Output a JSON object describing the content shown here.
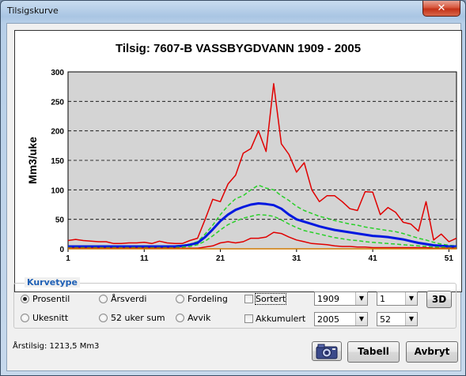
{
  "window": {
    "title": "Tilsigskurve",
    "close_label": "✕"
  },
  "chart_data": {
    "type": "line",
    "title": "Tilsig: 7607-B VASSBYGDVANN  1909 -  2005",
    "ylabel": "Mm3/uke",
    "xlabel": "",
    "xlim": [
      1,
      52
    ],
    "ylim": [
      0,
      300
    ],
    "y_ticks": [
      0,
      50,
      100,
      150,
      200,
      250,
      300
    ],
    "x_ticks": [
      1,
      11,
      21,
      31,
      41,
      51
    ],
    "grid": "horizontal dashed",
    "background": "#d4d4d4",
    "x": [
      1,
      2,
      3,
      4,
      5,
      6,
      7,
      8,
      9,
      10,
      11,
      12,
      13,
      14,
      15,
      16,
      17,
      18,
      19,
      20,
      21,
      22,
      23,
      24,
      25,
      26,
      27,
      28,
      29,
      30,
      31,
      32,
      33,
      34,
      35,
      36,
      37,
      38,
      39,
      40,
      41,
      42,
      43,
      44,
      45,
      46,
      47,
      48,
      49,
      50,
      51,
      52
    ],
    "series": [
      {
        "color": "#e00000",
        "width": 1.5,
        "values": [
          14,
          16,
          14,
          13,
          12,
          12,
          9,
          9,
          10,
          10,
          11,
          9,
          13,
          10,
          9,
          9,
          14,
          18,
          50,
          84,
          80,
          110,
          125,
          162,
          170,
          200,
          165,
          280,
          178,
          160,
          130,
          146,
          100,
          80,
          90,
          90,
          80,
          68,
          65,
          97,
          96,
          58,
          70,
          62,
          45,
          42,
          30,
          80,
          15,
          25,
          12,
          18
        ]
      },
      {
        "color": "#28d028",
        "width": 1.5,
        "dash": "5,3",
        "values": [
          5,
          5,
          5,
          5,
          5,
          5,
          5,
          5,
          5,
          5,
          5,
          5,
          5,
          5,
          5,
          6,
          8,
          12,
          25,
          40,
          58,
          73,
          85,
          90,
          100,
          108,
          103,
          100,
          90,
          82,
          72,
          65,
          60,
          55,
          52,
          48,
          45,
          42,
          40,
          37,
          35,
          33,
          31,
          29,
          26,
          22,
          18,
          15,
          11,
          8,
          6,
          5
        ]
      },
      {
        "color": "#0018e0",
        "width": 3,
        "values": [
          4,
          4,
          4,
          4,
          4,
          4,
          4,
          4,
          4,
          4,
          4,
          4,
          4,
          4,
          4,
          5,
          7,
          10,
          20,
          33,
          47,
          58,
          66,
          71,
          75,
          77,
          76,
          74,
          68,
          58,
          50,
          46,
          42,
          38,
          35,
          32,
          30,
          28,
          26,
          24,
          22,
          21,
          20,
          18,
          16,
          13,
          10,
          8,
          6,
          5,
          4,
          4
        ]
      },
      {
        "color": "#28d028",
        "width": 1.5,
        "dash": "5,3",
        "values": [
          2,
          2,
          2,
          2,
          2,
          2,
          2,
          2,
          2,
          2,
          2,
          2,
          2,
          2,
          2,
          3,
          4,
          7,
          13,
          22,
          32,
          41,
          47,
          52,
          55,
          58,
          57,
          55,
          49,
          42,
          36,
          31,
          28,
          25,
          22,
          19,
          17,
          15,
          14,
          12,
          11,
          10,
          9,
          8,
          7,
          6,
          5,
          4,
          3,
          3,
          2,
          2
        ]
      },
      {
        "color": "#e00000",
        "width": 1.5,
        "values": [
          1,
          1,
          1,
          1,
          1,
          1,
          1,
          1,
          1,
          1,
          1,
          1,
          1,
          1,
          1,
          1,
          1,
          1,
          3,
          5,
          10,
          12,
          10,
          12,
          18,
          18,
          20,
          28,
          26,
          20,
          15,
          12,
          9,
          8,
          7,
          5,
          4,
          4,
          3,
          3,
          2,
          2,
          2,
          2,
          2,
          2,
          2,
          2,
          1,
          1,
          1,
          1
        ]
      },
      {
        "color": "#d07a00",
        "width": 1.5,
        "values": [
          0,
          0,
          0,
          0,
          0,
          0,
          0,
          0,
          0,
          0,
          0,
          0,
          0,
          0,
          0,
          0,
          0,
          0,
          0,
          0,
          0,
          0,
          0,
          0,
          0,
          0,
          0,
          0,
          0,
          0,
          0,
          0,
          0,
          0,
          0,
          0,
          0,
          0,
          0,
          0,
          0,
          0,
          0,
          0,
          0,
          0,
          0,
          0,
          0,
          0,
          0,
          0
        ]
      }
    ]
  },
  "curve_type": {
    "legend": "Kurvetype",
    "options": [
      {
        "label": "Prosentil",
        "selected": true
      },
      {
        "label": "Årsverdi",
        "selected": false
      },
      {
        "label": "Fordeling",
        "selected": false
      },
      {
        "label": "Ukesnitt",
        "selected": false
      },
      {
        "label": "52 uker sum",
        "selected": false
      },
      {
        "label": "Avvik",
        "selected": false
      }
    ]
  },
  "options": {
    "sortert_label": "Sortert",
    "akkumulert_label": "Akkumulert",
    "from_year": "1909",
    "to_year": "2005",
    "from_week": "1",
    "to_week": "52",
    "btn_3d": "3D"
  },
  "status": {
    "text": "Årstilsig: 1213,5 Mm3"
  },
  "buttons": {
    "table": "Tabell",
    "cancel": "Avbryt"
  },
  "icons": {
    "camera": "camera-icon",
    "dropdown": "▼"
  }
}
